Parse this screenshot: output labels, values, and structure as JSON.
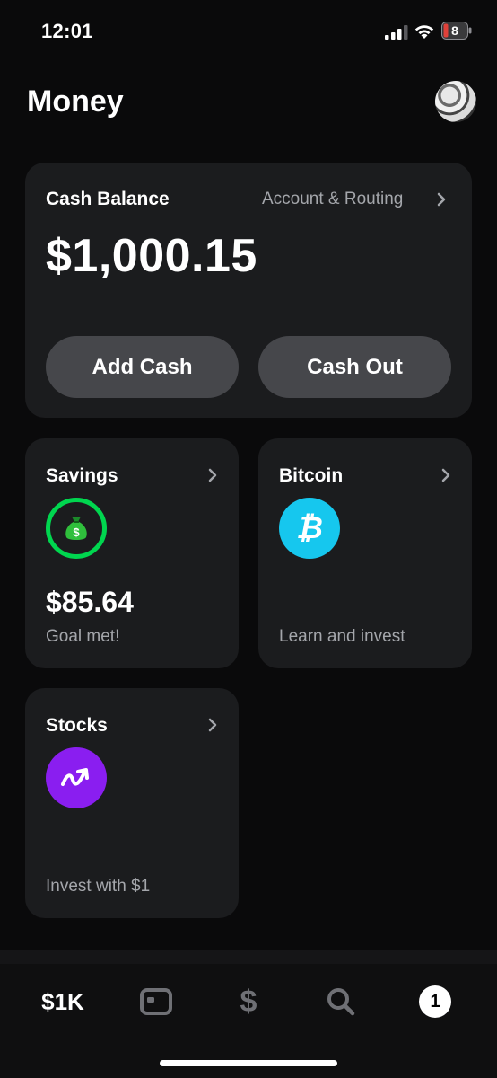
{
  "status_bar": {
    "time": "12:01",
    "battery_level": "8"
  },
  "header": {
    "title": "Money"
  },
  "balance_card": {
    "label": "Cash Balance",
    "routing_link": "Account & Routing",
    "amount": "$1,000.15",
    "add_cash": "Add Cash",
    "cash_out": "Cash Out"
  },
  "savings_card": {
    "label": "Savings",
    "amount": "$85.64",
    "subtitle": "Goal met!",
    "icon": "money-bag-icon"
  },
  "bitcoin_card": {
    "label": "Bitcoin",
    "subtitle": "Learn and invest",
    "icon": "bitcoin-icon",
    "icon_glyph": "₿"
  },
  "stocks_card": {
    "label": "Stocks",
    "subtitle": "Invest with $1",
    "icon": "trend-up-icon"
  },
  "bottom_nav": {
    "balance": "$1K",
    "dollar": "$",
    "activity_count": "1"
  },
  "colors": {
    "background": "#0a0a0b",
    "card": "#1b1c1e",
    "button": "#46474b",
    "savings_accent": "#00d64f",
    "bitcoin_accent": "#16c7ee",
    "stocks_accent": "#8a1ef0",
    "battery_low": "#e0413a"
  }
}
